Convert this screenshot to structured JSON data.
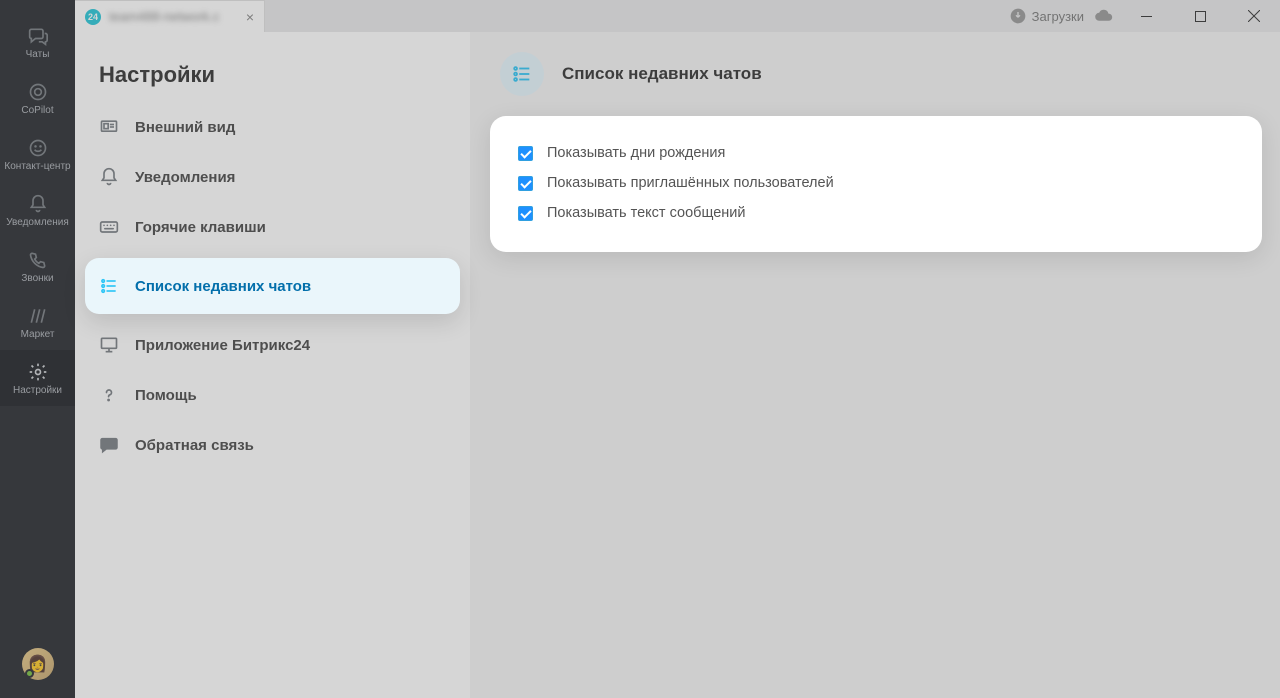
{
  "titlebar": {
    "tab_label": "team488-network.c",
    "tab_favicon_text": "24",
    "downloads_label": "Загрузки"
  },
  "sidebar": {
    "items": [
      {
        "id": "chats",
        "label": "Чаты",
        "icon": "chat-icon"
      },
      {
        "id": "copilot",
        "label": "CoPilot",
        "icon": "copilot-icon"
      },
      {
        "id": "contact",
        "label": "Контакт-центр",
        "icon": "contactcenter-icon"
      },
      {
        "id": "notifications",
        "label": "Уведомления",
        "icon": "bell-icon"
      },
      {
        "id": "calls",
        "label": "Звонки",
        "icon": "phone-icon"
      },
      {
        "id": "market",
        "label": "Маркет",
        "icon": "market-icon"
      },
      {
        "id": "settings",
        "label": "Настройки",
        "icon": "gear-icon"
      }
    ],
    "active_id": "settings"
  },
  "settings": {
    "title": "Настройки",
    "items": [
      {
        "id": "appearance",
        "label": "Внешний вид",
        "icon": "appearance-icon"
      },
      {
        "id": "notify",
        "label": "Уведомления",
        "icon": "bell-icon"
      },
      {
        "id": "hotkeys",
        "label": "Горячие клавиши",
        "icon": "keyboard-icon"
      },
      {
        "id": "recent-chats",
        "label": "Список недавних чатов",
        "icon": "list-icon"
      },
      {
        "id": "desktop-app",
        "label": "Приложение Битрикс24",
        "icon": "desktop-icon"
      },
      {
        "id": "help",
        "label": "Помощь",
        "icon": "help-icon"
      },
      {
        "id": "feedback",
        "label": "Обратная связь",
        "icon": "feedback-icon"
      }
    ],
    "active_id": "recent-chats"
  },
  "detail": {
    "title": "Список недавних чатов",
    "options": [
      {
        "id": "birthdays",
        "label": "Показывать дни рождения",
        "checked": true
      },
      {
        "id": "invited",
        "label": "Показывать приглашённых пользователей",
        "checked": true
      },
      {
        "id": "msgtext",
        "label": "Показывать текст сообщений",
        "checked": true
      }
    ]
  }
}
